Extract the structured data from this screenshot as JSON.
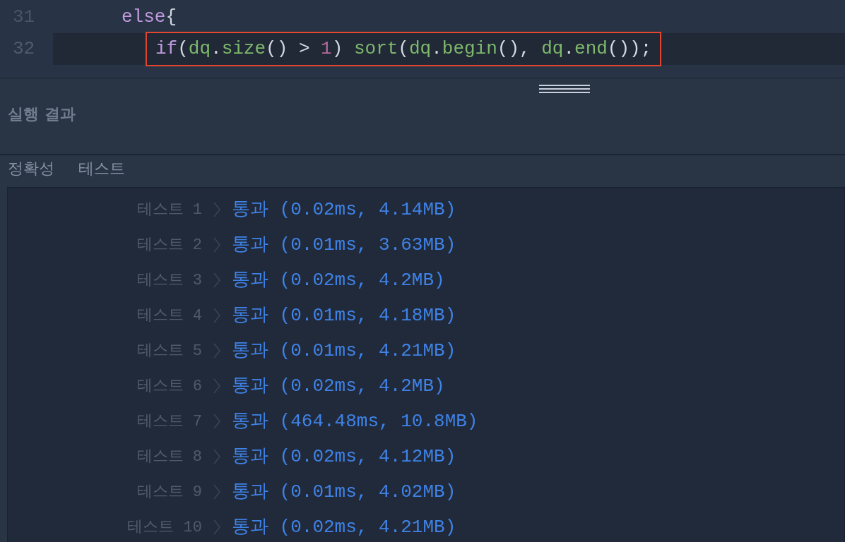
{
  "editor": {
    "lines": [
      {
        "number": "31",
        "current": false,
        "tokens": [
          {
            "kind": "keyword",
            "text": "else"
          },
          {
            "kind": "punct",
            "text": "{"
          }
        ],
        "children": [
          {
            "number": "32",
            "current": true,
            "tokens": [
              {
                "kind": "keyword",
                "text": "if"
              },
              {
                "kind": "punct",
                "text": "("
              },
              {
                "kind": "ident",
                "text": "dq"
              },
              {
                "kind": "punct",
                "text": "."
              },
              {
                "kind": "ident",
                "text": "size"
              },
              {
                "kind": "punct",
                "text": "() > "
              },
              {
                "kind": "number",
                "text": "1"
              },
              {
                "kind": "punct",
                "text": ") "
              },
              {
                "kind": "ident",
                "text": "sort"
              },
              {
                "kind": "punct",
                "text": "("
              },
              {
                "kind": "ident",
                "text": "dq"
              },
              {
                "kind": "punct",
                "text": "."
              },
              {
                "kind": "ident",
                "text": "begin"
              },
              {
                "kind": "punct",
                "text": "(), "
              },
              {
                "kind": "ident",
                "text": "dq"
              },
              {
                "kind": "punct",
                "text": "."
              },
              {
                "kind": "ident",
                "text": "end"
              },
              {
                "kind": "punct",
                "text": "());"
              }
            ]
          }
        ]
      }
    ]
  },
  "panel": {
    "title": "실행 결과",
    "tabs": [
      {
        "label": "정확성"
      },
      {
        "label": "테스트"
      }
    ],
    "results": [
      {
        "label": "테스트 1",
        "text": "통과 (0.02ms, 4.14MB)"
      },
      {
        "label": "테스트 2",
        "text": "통과 (0.01ms, 3.63MB)"
      },
      {
        "label": "테스트 3",
        "text": "통과 (0.02ms, 4.2MB)"
      },
      {
        "label": "테스트 4",
        "text": "통과 (0.01ms, 4.18MB)"
      },
      {
        "label": "테스트 5",
        "text": "통과 (0.01ms, 4.21MB)"
      },
      {
        "label": "테스트 6",
        "text": "통과 (0.02ms, 4.2MB)"
      },
      {
        "label": "테스트 7",
        "text": "통과 (464.48ms, 10.8MB)"
      },
      {
        "label": "테스트 8",
        "text": "통과 (0.02ms, 4.12MB)"
      },
      {
        "label": "테스트 9",
        "text": "통과 (0.01ms, 4.02MB)"
      },
      {
        "label": "테스트 10",
        "text": "통과 (0.02ms, 4.21MB)"
      }
    ]
  }
}
